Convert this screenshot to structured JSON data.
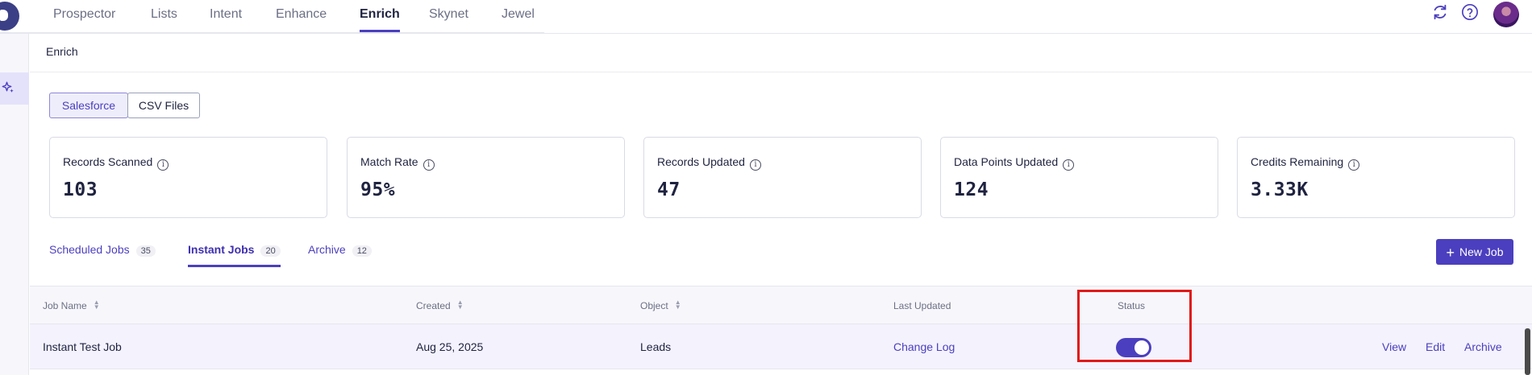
{
  "nav": {
    "tabs": [
      "Prospector",
      "Lists",
      "Intent",
      "Enhance",
      "Enrich",
      "Skynet",
      "Jewel"
    ],
    "active_tab": "Enrich",
    "icons": [
      "refresh-icon",
      "help-icon"
    ]
  },
  "breadcrumb": "Enrich",
  "sources": {
    "salesforce": "Salesforce",
    "csv": "CSV Files",
    "active": "Salesforce"
  },
  "stats": [
    {
      "label": "Records Scanned",
      "value": "103"
    },
    {
      "label": "Match Rate",
      "value": "95%"
    },
    {
      "label": "Records Updated",
      "value": "47"
    },
    {
      "label": "Data Points Updated",
      "value": "124"
    },
    {
      "label": "Credits Remaining",
      "value": "3.33K"
    }
  ],
  "job_tabs": [
    {
      "label": "Scheduled Jobs",
      "count": "35"
    },
    {
      "label": "Instant Jobs",
      "count": "20"
    },
    {
      "label": "Archive",
      "count": "12"
    }
  ],
  "active_job_tab": "Instant Jobs",
  "new_job_label": "New Job",
  "table": {
    "headers": [
      "Job Name",
      "Created",
      "Object",
      "Last Updated",
      "Status"
    ],
    "rows": [
      {
        "job_name": "Instant Test Job",
        "created": "Aug 25, 2025",
        "object": "Leads",
        "last_updated": "Change Log",
        "status_on": true,
        "actions": [
          "View",
          "Edit",
          "Archive"
        ]
      }
    ]
  },
  "colors": {
    "accent": "#4b3fbf",
    "highlight": "#e01919"
  }
}
